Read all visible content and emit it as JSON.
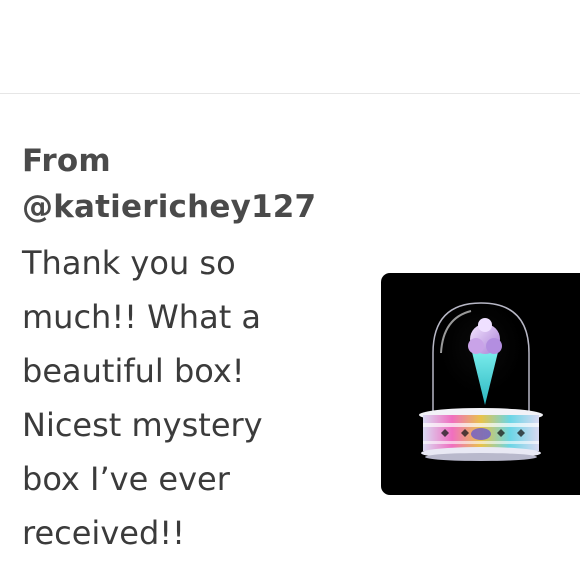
{
  "review": {
    "from_label": "From",
    "username": "@katierichey127",
    "message": "Thank you so much!! What a beautiful box! Nicest mystery box I’ve ever received!!"
  },
  "product_image": {
    "icon": "snow-globe-ice-cream-icon",
    "colors": {
      "background": "#000000",
      "cone": "#4fd8d8",
      "scoop": "#c9a3e8",
      "base_gold": "#e8c34a",
      "base_pink": "#f06fc0"
    }
  }
}
